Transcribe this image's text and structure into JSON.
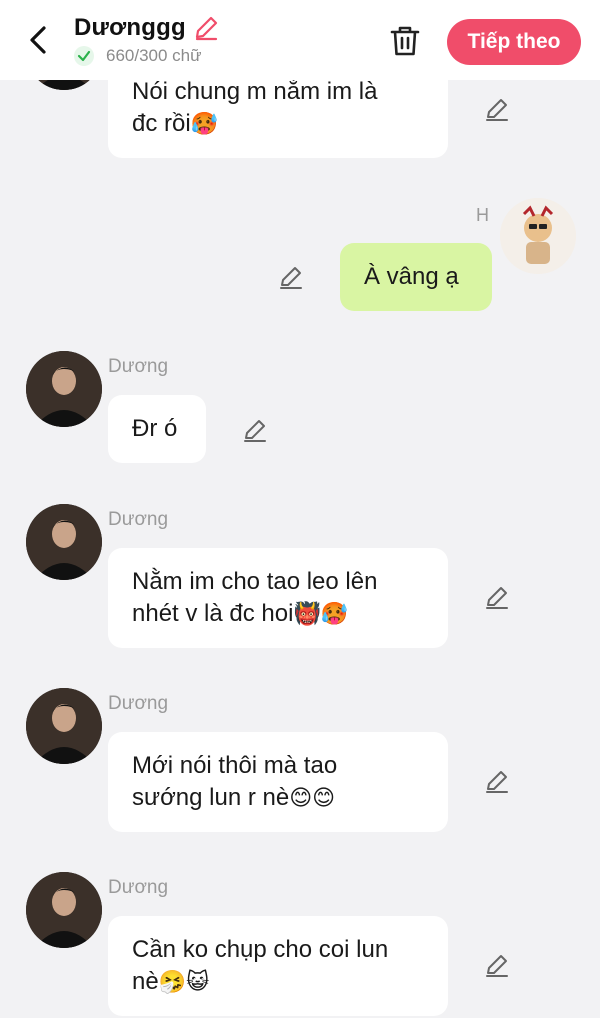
{
  "header": {
    "title": "Dươnggg",
    "counter": "660/300 chữ",
    "next_label": "Tiếp theo"
  },
  "messages": [
    {
      "sender": "",
      "line1": "Nói chung m nằm im là",
      "line2": "đc rồi",
      "emojis": "🥵"
    },
    {
      "sender": "H",
      "text": "À vâng ạ"
    },
    {
      "sender": "Dương",
      "text": "Đr ó"
    },
    {
      "sender": "Dương",
      "line1": "Nằm im cho tao leo lên",
      "line2": "nhét v là đc hoi",
      "emojis": "👹🥵"
    },
    {
      "sender": "Dương",
      "line1": "Mới nói thôi mà tao",
      "line2": "sướng lun r nè",
      "emojis": "😊😊"
    },
    {
      "sender": "Dương",
      "line1": "Cần ko chụp cho coi lun",
      "line2": "nè",
      "emojis": "🤧😺"
    }
  ],
  "colors": {
    "accent": "#f04d6a",
    "my_bubble": "#d9f5a3",
    "their_bubble": "#ffffff",
    "background": "#f2f2f4"
  },
  "icons": [
    "back-arrow-icon",
    "pencil-icon",
    "check-icon",
    "trash-icon"
  ]
}
